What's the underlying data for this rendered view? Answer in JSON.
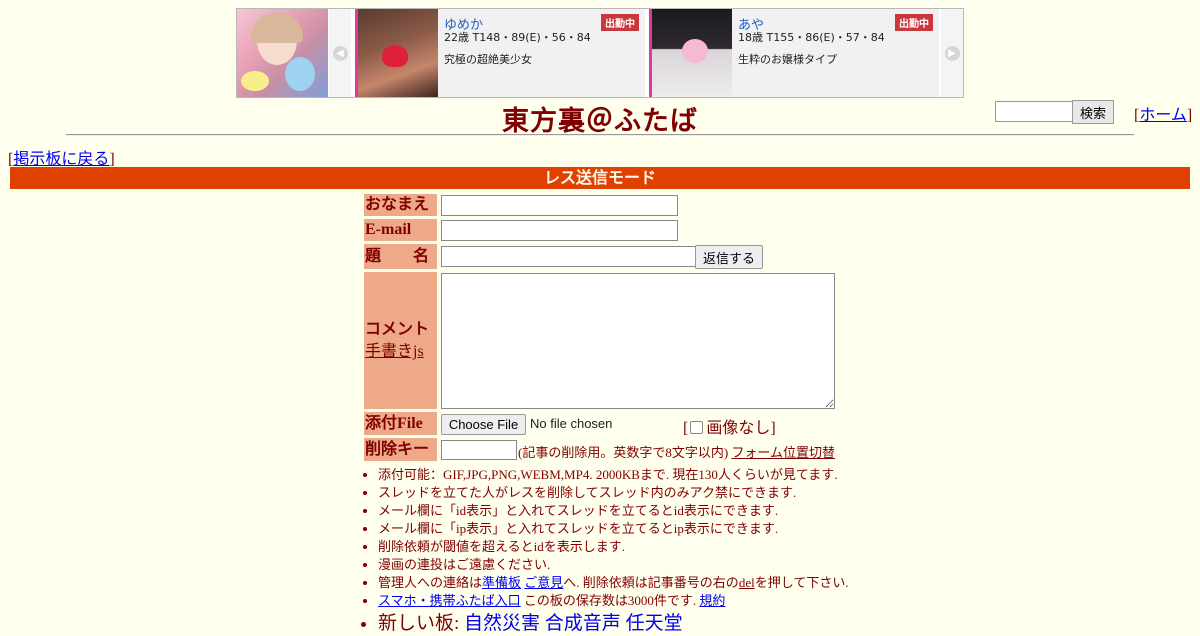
{
  "banner": {
    "cards": [
      {
        "name": "ゆめか",
        "badge": "出勤中",
        "stats": "22歳 T148・89(E)・56・84",
        "desc": "究極の超絶美少女"
      },
      {
        "name": "あや",
        "badge": "出勤中",
        "stats": "18歳 T155・86(E)・57・84",
        "desc": "生粋のお嬢様タイプ"
      }
    ]
  },
  "header": {
    "title": "東方裏＠ふたば",
    "search_button": "検索",
    "home_link": "ホーム",
    "back_link": "掲示板に戻る"
  },
  "mode_bar": "レス送信モード",
  "form": {
    "name_label": "おなまえ",
    "email_label": "E-mail",
    "subject_label": "題　　名",
    "submit_label": "返信する",
    "comment_label": "コメント",
    "tegaki_link": "手書きjs",
    "file_label": "添付File",
    "choose_file": "Choose File",
    "no_file": "No file chosen",
    "no_image": "画像なし",
    "delkey_label": "削除キー",
    "delkey_note": "(記事の削除用。英数字で8文字以内)",
    "form_toggle": "フォーム位置切替"
  },
  "notes": {
    "n1": "添付可能：GIF,JPG,PNG,WEBM,MP4. 2000KBまで. 現在130人くらいが見てます.",
    "n2": "スレッドを立てた人がレスを削除してスレッド内のみアク禁にできます.",
    "n3": "メール欄に「id表示」と入れてスレッドを立てるとid表示にできます.",
    "n4": "メール欄に「ip表示」と入れてスレッドを立てるとip表示にできます.",
    "n5": "削除依頼が閾値を超えるとidを表示します.",
    "n6": "漫画の連投はご遠慮ください.",
    "n7_pre": "管理人への連絡は",
    "n7_link1": "準備板",
    "n7_link2": "ご意見",
    "n7_mid": "へ. 削除依頼は記事番号の右の",
    "n7_del": "del",
    "n7_post": "を押して下さい.",
    "n8_link": "スマホ・携帯ふたば入口",
    "n8_text": " この板の保存数は3000件です.",
    "n8_rules": "規約",
    "n9_pre": "新しい板: ",
    "n9_links": [
      "自然災害",
      "合成音声",
      "任天堂"
    ]
  }
}
